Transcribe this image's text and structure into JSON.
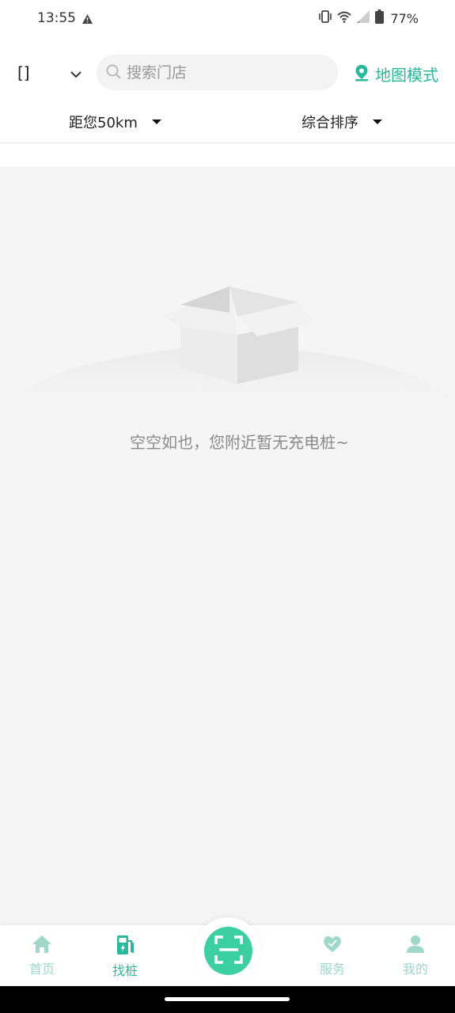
{
  "status_bar": {
    "time": "13:55",
    "battery": "77%",
    "icons": [
      "alert-icon",
      "vibrate-icon",
      "wifi-icon",
      "signal-icon",
      "battery-icon"
    ]
  },
  "header": {
    "city": "[]",
    "search_placeholder": "搜索门店",
    "map_mode_label": "地图模式"
  },
  "filters": {
    "distance_label": "距您50km",
    "sort_label": "综合排序"
  },
  "empty_state": {
    "message": "空空如也，您附近暂无充电桩~"
  },
  "tab_bar": {
    "tabs": [
      {
        "label": "首页",
        "icon": "home-icon",
        "active": false
      },
      {
        "label": "找桩",
        "icon": "charging-station-icon",
        "active": true
      },
      {
        "label": "服务",
        "icon": "heart-icon",
        "active": false
      },
      {
        "label": "我的",
        "icon": "user-icon",
        "active": false
      }
    ],
    "center_icon": "scan-icon"
  },
  "colors": {
    "accent": "#2bb89a",
    "scan_button": "#3ccf9f",
    "tab_inactive": "#9fd8c9",
    "background": "#f5f5f5"
  }
}
